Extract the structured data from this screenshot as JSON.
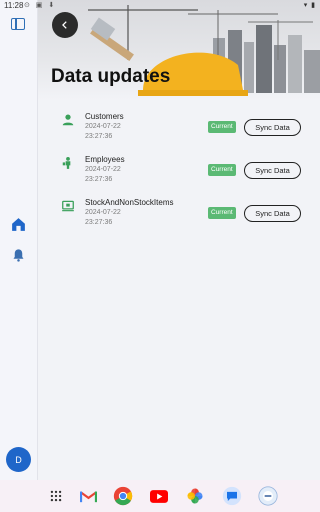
{
  "status": {
    "time": "11:28"
  },
  "page": {
    "title": "Data updates"
  },
  "rail": {
    "avatar_initial": "D"
  },
  "items": [
    {
      "name": "Customers",
      "date": "2024-07-22",
      "time": "23:27:36",
      "status": "Current",
      "action": "Sync Data",
      "icon": "person-icon"
    },
    {
      "name": "Employees",
      "date": "2024-07-22",
      "time": "23:27:36",
      "status": "Current",
      "action": "Sync Data",
      "icon": "employee-icon"
    },
    {
      "name": "StockAndNonStockItems",
      "date": "2024-07-22",
      "time": "23:27:36",
      "status": "Current",
      "action": "Sync Data",
      "icon": "inventory-icon"
    }
  ],
  "colors": {
    "accent": "#1f66c9",
    "current_badge": "#5bb974",
    "icon_green": "#3aa05a"
  },
  "taskbar": {
    "apps": [
      "app-drawer-icon",
      "gmail-icon",
      "chrome-icon",
      "youtube-icon",
      "photos-icon",
      "messages-icon",
      "app-icon"
    ]
  }
}
